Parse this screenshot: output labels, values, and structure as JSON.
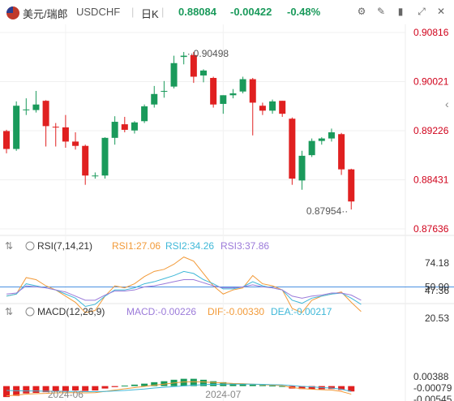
{
  "header": {
    "pair_name": "美元/瑞郎",
    "symbol": "USDCHF",
    "period": "日K",
    "last_price": "0.88084",
    "change": "-0.00422",
    "change_pct": "-0.48%"
  },
  "colors": {
    "up": "#1a9a5b",
    "down": "#e02020",
    "price_axis_text": "#d0021b",
    "rsi1": "#f29a38",
    "rsi2": "#3fb8d8",
    "rsi3": "#9b7ad9",
    "rsi_level_line": "#4a90e2",
    "macd_dif": "#f29a38",
    "macd_dea": "#3fb8d8"
  },
  "chart_data": [
    {
      "type": "candlestick",
      "title": "USDCHF 日K",
      "price_ticks": [
        "0.90816",
        "0.90021",
        "0.89226",
        "0.88431",
        "0.87636"
      ],
      "ylim": [
        0.87636,
        0.90816
      ],
      "x_ticks": [
        "2024-06",
        "2024-07"
      ],
      "annotations": {
        "max_label": "0.90498",
        "min_label": "0.87954"
      },
      "candles": [
        {
          "o": 0.8922,
          "h": 0.8924,
          "l": 0.8886,
          "c": 0.8893
        },
        {
          "o": 0.8893,
          "h": 0.897,
          "l": 0.889,
          "c": 0.8963
        },
        {
          "o": 0.8956,
          "h": 0.8975,
          "l": 0.8948,
          "c": 0.8957
        },
        {
          "o": 0.8956,
          "h": 0.8987,
          "l": 0.8952,
          "c": 0.8965
        },
        {
          "o": 0.8971,
          "h": 0.8972,
          "l": 0.8897,
          "c": 0.893
        },
        {
          "o": 0.8929,
          "h": 0.8935,
          "l": 0.8897,
          "c": 0.8928
        },
        {
          "o": 0.8928,
          "h": 0.8948,
          "l": 0.8895,
          "c": 0.8905
        },
        {
          "o": 0.8905,
          "h": 0.892,
          "l": 0.8892,
          "c": 0.8898
        },
        {
          "o": 0.8898,
          "h": 0.89,
          "l": 0.8835,
          "c": 0.885
        },
        {
          "o": 0.885,
          "h": 0.8855,
          "l": 0.8845,
          "c": 0.885
        },
        {
          "o": 0.885,
          "h": 0.8912,
          "l": 0.8845,
          "c": 0.8911
        },
        {
          "o": 0.8911,
          "h": 0.8946,
          "l": 0.89,
          "c": 0.8937
        },
        {
          "o": 0.8933,
          "h": 0.8945,
          "l": 0.892,
          "c": 0.8924
        },
        {
          "o": 0.8923,
          "h": 0.8938,
          "l": 0.8918,
          "c": 0.8936
        },
        {
          "o": 0.8938,
          "h": 0.8965,
          "l": 0.8935,
          "c": 0.8962
        },
        {
          "o": 0.8965,
          "h": 0.8995,
          "l": 0.896,
          "c": 0.8982
        },
        {
          "o": 0.8986,
          "h": 0.9003,
          "l": 0.8976,
          "c": 0.8987
        },
        {
          "o": 0.8994,
          "h": 0.9044,
          "l": 0.8991,
          "c": 0.9032
        },
        {
          "o": 0.9042,
          "h": 0.905,
          "l": 0.903,
          "c": 0.9044
        },
        {
          "o": 0.9045,
          "h": 0.905,
          "l": 0.9,
          "c": 0.901
        },
        {
          "o": 0.9012,
          "h": 0.9022,
          "l": 0.9001,
          "c": 0.902
        },
        {
          "o": 0.9008,
          "h": 0.901,
          "l": 0.896,
          "c": 0.8965
        },
        {
          "o": 0.8966,
          "h": 0.898,
          "l": 0.895,
          "c": 0.898
        },
        {
          "o": 0.898,
          "h": 0.899,
          "l": 0.8975,
          "c": 0.8983
        },
        {
          "o": 0.8986,
          "h": 0.901,
          "l": 0.8983,
          "c": 0.9006
        },
        {
          "o": 0.9006,
          "h": 0.9008,
          "l": 0.8915,
          "c": 0.8968
        },
        {
          "o": 0.8963,
          "h": 0.8968,
          "l": 0.8948,
          "c": 0.8955
        },
        {
          "o": 0.8955,
          "h": 0.8973,
          "l": 0.895,
          "c": 0.897
        },
        {
          "o": 0.8971,
          "h": 0.8971,
          "l": 0.8945,
          "c": 0.895
        },
        {
          "o": 0.8942,
          "h": 0.8944,
          "l": 0.8835,
          "c": 0.8845
        },
        {
          "o": 0.8842,
          "h": 0.889,
          "l": 0.8827,
          "c": 0.8882
        },
        {
          "o": 0.8883,
          "h": 0.891,
          "l": 0.888,
          "c": 0.8906
        },
        {
          "o": 0.8906,
          "h": 0.8912,
          "l": 0.89,
          "c": 0.891
        },
        {
          "o": 0.891,
          "h": 0.8926,
          "l": 0.8905,
          "c": 0.892
        },
        {
          "o": 0.8917,
          "h": 0.8919,
          "l": 0.8851,
          "c": 0.886
        },
        {
          "o": 0.886,
          "h": 0.8861,
          "l": 0.8795,
          "c": 0.8808
        }
      ]
    },
    {
      "type": "line",
      "title": "RSI(7,14,21)",
      "legend": [
        {
          "name": "RSI1",
          "value": "27.06"
        },
        {
          "name": "RSI2",
          "value": "34.26"
        },
        {
          "name": "RSI3",
          "value": "37.86"
        }
      ],
      "y_ticks": [
        "74.18",
        "50.90",
        "47.36",
        "20.53"
      ],
      "ylim": [
        20.53,
        74.18
      ],
      "level_line": 50.9,
      "series": [
        {
          "name": "RSI1",
          "values": [
            42,
            44,
            60,
            58,
            52,
            48,
            42,
            36,
            26,
            28,
            42,
            52,
            50,
            54,
            61,
            66,
            68,
            73,
            80,
            76,
            64,
            52,
            44,
            48,
            50,
            62,
            54,
            52,
            48,
            30,
            26,
            38,
            42,
            44,
            46,
            36,
            27
          ]
        },
        {
          "name": "RSI2",
          "values": [
            42,
            44,
            54,
            52,
            50,
            48,
            44,
            40,
            32,
            34,
            42,
            48,
            48,
            50,
            54,
            56,
            59,
            62,
            66,
            64,
            58,
            54,
            49,
            49,
            51,
            56,
            52,
            50,
            48,
            38,
            35,
            40,
            42,
            44,
            45,
            40,
            34
          ]
        },
        {
          "name": "RSI3",
          "values": [
            44,
            45,
            52,
            51,
            50,
            48,
            46,
            42,
            38,
            38,
            43,
            47,
            47,
            48,
            51,
            52,
            54,
            56,
            58,
            58,
            55,
            52,
            50,
            50,
            51,
            53,
            51,
            50,
            48,
            42,
            40,
            42,
            43,
            45,
            45,
            43,
            38
          ]
        }
      ]
    },
    {
      "type": "bar",
      "title": "MACD(12,26,9)",
      "legend": [
        {
          "name": "MACD",
          "value": "-0.00226"
        },
        {
          "name": "DIF",
          "value": "-0.00330"
        },
        {
          "name": "DEA",
          "value": "-0.00217"
        }
      ],
      "y_ticks": [
        "0.00388",
        "-0.00079",
        "-0.00545"
      ],
      "ylim": [
        -0.00545,
        0.00388
      ],
      "histogram": [
        -0.0045,
        -0.004,
        -0.003,
        -0.0028,
        -0.0025,
        -0.0022,
        -0.002,
        -0.0018,
        -0.002,
        -0.0018,
        -0.001,
        -0.0004,
        0.0002,
        0.0006,
        0.001,
        0.0016,
        0.002,
        0.0026,
        0.003,
        0.003,
        0.0026,
        0.002,
        0.0016,
        0.0012,
        0.001,
        0.0006,
        0.0004,
        0.0002,
        0.0,
        -0.001,
        -0.0012,
        -0.0013,
        -0.0013,
        -0.0012,
        -0.0016,
        -0.0022
      ],
      "series": [
        {
          "name": "DIF",
          "values": [
            -0.004,
            -0.0037,
            -0.0033,
            -0.0031,
            -0.003,
            -0.0028,
            -0.0027,
            -0.0027,
            -0.0028,
            -0.0027,
            -0.0022,
            -0.0016,
            -0.0011,
            -0.0006,
            -0.0001,
            0.0004,
            0.0008,
            0.0013,
            0.0017,
            0.0018,
            0.0017,
            0.0015,
            0.0013,
            0.0011,
            0.001,
            0.0008,
            0.0006,
            0.0004,
            0.0002,
            -0.0006,
            -0.001,
            -0.0013,
            -0.0015,
            -0.0016,
            -0.0022,
            -0.0033
          ]
        },
        {
          "name": "DEA",
          "values": [
            -0.0018,
            -0.0019,
            -0.002,
            -0.002,
            -0.0021,
            -0.0021,
            -0.0022,
            -0.0022,
            -0.0023,
            -0.0023,
            -0.0022,
            -0.002,
            -0.0018,
            -0.0015,
            -0.0012,
            -0.0008,
            -0.0005,
            -0.0002,
            0.0001,
            0.0004,
            0.0006,
            0.0007,
            0.0008,
            0.0008,
            0.0008,
            0.0008,
            0.0007,
            0.0006,
            0.0005,
            0.0002,
            -0.0001,
            -0.0003,
            -0.0006,
            -0.0008,
            -0.0013,
            -0.0022
          ]
        }
      ]
    }
  ]
}
